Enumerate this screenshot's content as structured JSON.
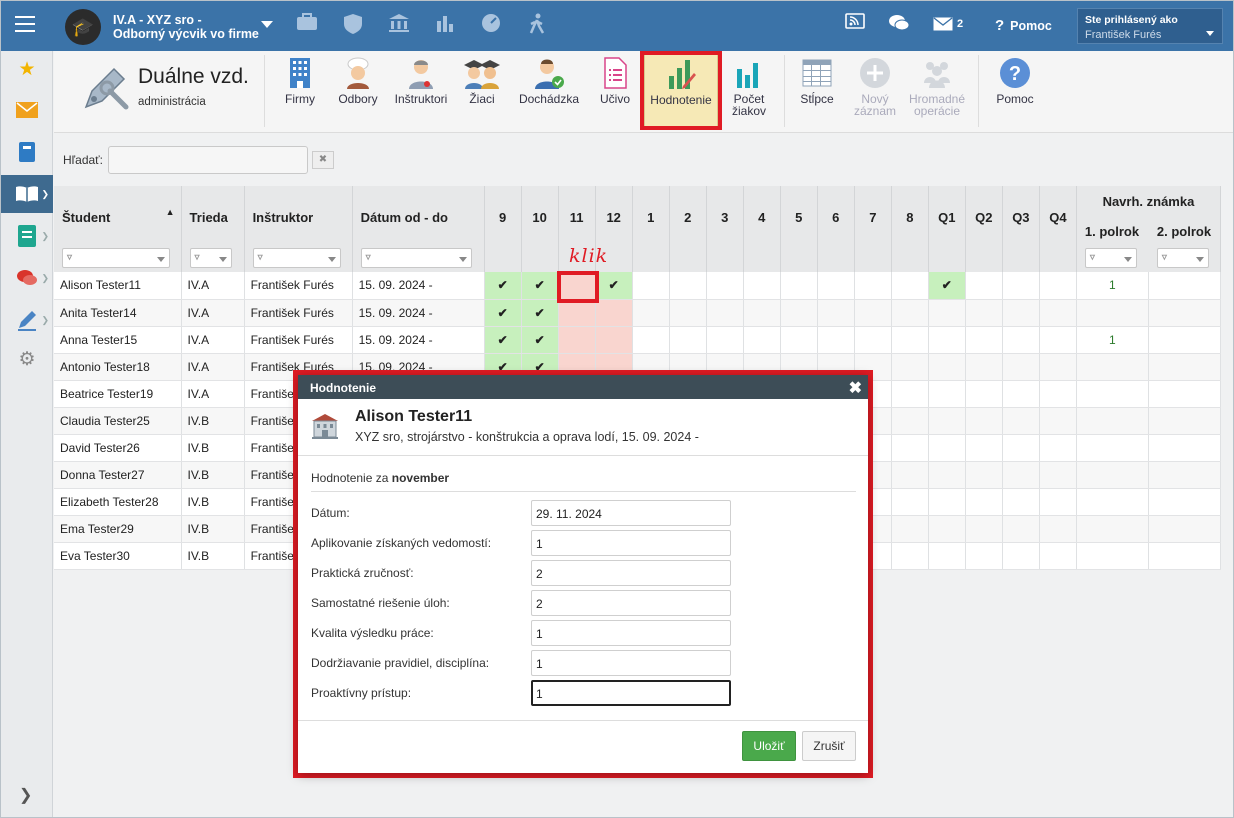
{
  "header": {
    "org_line1": "IV.A - XYZ sro -",
    "org_line2": "Odborný výcvik vo firme",
    "mail_count": "2",
    "help_label": "Pomoc",
    "user_label": "Ste prihlásený ako",
    "user_name": "František Furés"
  },
  "module": {
    "title": "Duálne vzd.",
    "subtitle": "administrácia"
  },
  "toolbar": [
    {
      "label": "Firmy",
      "icon": "building-icon"
    },
    {
      "label": "Odbory",
      "icon": "chef-icon"
    },
    {
      "label": "Inštruktori",
      "icon": "instructor-icon"
    },
    {
      "label": "Žiaci",
      "icon": "students-icon"
    },
    {
      "label": "Dochádzka",
      "icon": "attendance-icon"
    },
    {
      "label": "Učivo",
      "icon": "document-icon"
    },
    {
      "label": "Hodnotenie",
      "icon": "evaluation-chart-icon",
      "active": true
    },
    {
      "label": "Počet",
      "label2": "žiakov",
      "icon": "bar-chart-icon"
    },
    {
      "label": "Stĺpce",
      "icon": "columns-icon"
    },
    {
      "label": "Nový",
      "label2": "záznam",
      "icon": "plus-icon",
      "disabled": true
    },
    {
      "label": "Hromadné",
      "label2": "operácie",
      "icon": "group-icon",
      "disabled": true
    },
    {
      "label": "Pomoc",
      "icon": "help-icon"
    }
  ],
  "search": {
    "label": "Hľadať:",
    "value": ""
  },
  "grid": {
    "headers": {
      "student": "Študent",
      "class": "Trieda",
      "instructor": "Inštruktor",
      "date": "Dátum od - do",
      "months": [
        "9",
        "10",
        "11",
        "12",
        "1",
        "2",
        "3",
        "4",
        "5",
        "6",
        "7",
        "8"
      ],
      "quarters": [
        "Q1",
        "Q2",
        "Q3",
        "Q4"
      ],
      "proposed": "Navrh. známka",
      "half1": "1. polrok",
      "half2": "2. polrok"
    },
    "rows": [
      {
        "name": "Alison Tester11",
        "class": "IV.A",
        "instructor": "František Furés",
        "date": "15. 09. 2024 -",
        "m9": "✔",
        "m10": "✔",
        "m12": "✔",
        "q1": "✔",
        "p1": "1"
      },
      {
        "name": "Anita Tester14",
        "class": "IV.A",
        "instructor": "František Furés",
        "date": "15. 09. 2024 -",
        "m9": "✔",
        "m10": "✔",
        "m12": "",
        "q1": "",
        "p1": ""
      },
      {
        "name": "Anna Tester15",
        "class": "IV.A",
        "instructor": "František Furés",
        "date": "15. 09. 2024 -",
        "m9": "✔",
        "m10": "✔",
        "m12": "",
        "q1": "",
        "p1": "1"
      },
      {
        "name": "Antonio Tester18",
        "class": "IV.A",
        "instructor": "František Furés",
        "date": "15. 09. 2024 -",
        "m9": "✔",
        "m10": "✔",
        "m12": "",
        "q1": "",
        "p1": ""
      },
      {
        "name": "Beatrice Tester19",
        "class": "IV.A",
        "instructor": "František",
        "date": "",
        "m9": "",
        "m10": "",
        "m12": "",
        "q1": "",
        "p1": ""
      },
      {
        "name": "Claudia Tester25",
        "class": "IV.B",
        "instructor": "František",
        "date": "",
        "m9": "",
        "m10": "",
        "m12": "",
        "q1": "",
        "p1": ""
      },
      {
        "name": "David Tester26",
        "class": "IV.B",
        "instructor": "František",
        "date": "",
        "m9": "",
        "m10": "",
        "m12": "",
        "q1": "",
        "p1": ""
      },
      {
        "name": "Donna Tester27",
        "class": "IV.B",
        "instructor": "František",
        "date": "",
        "m9": "",
        "m10": "",
        "m12": "",
        "q1": "",
        "p1": ""
      },
      {
        "name": "Elizabeth Tester28",
        "class": "IV.B",
        "instructor": "František",
        "date": "",
        "m9": "",
        "m10": "",
        "m12": "",
        "q1": "",
        "p1": ""
      },
      {
        "name": "Ema Tester29",
        "class": "IV.B",
        "instructor": "František",
        "date": "",
        "m9": "",
        "m10": "",
        "m12": "",
        "q1": "",
        "p1": ""
      },
      {
        "name": "Eva Tester30",
        "class": "IV.B",
        "instructor": "František",
        "date": "",
        "m9": "",
        "m10": "",
        "m12": "",
        "q1": "",
        "p1": ""
      }
    ]
  },
  "annotation": {
    "klik": "klik"
  },
  "dialog": {
    "title": "Hodnotenie",
    "student": "Alison Tester11",
    "info": "XYZ sro, strojárstvo - konštrukcia a oprava lodí, 15. 09. 2024 -",
    "period_prefix": "Hodnotenie za",
    "period_month": "november",
    "fields": [
      {
        "label": "Dátum:",
        "value": "29. 11. 2024"
      },
      {
        "label": "Aplikovanie získaných vedomostí:",
        "value": "1"
      },
      {
        "label": "Praktická zručnosť:",
        "value": "2"
      },
      {
        "label": "Samostatné riešenie úloh:",
        "value": "2"
      },
      {
        "label": "Kvalita výsledku práce:",
        "value": "1"
      },
      {
        "label": "Dodržiavanie pravidiel, disciplína:",
        "value": "1"
      },
      {
        "label": "Proaktívny prístup:",
        "value": "1"
      }
    ],
    "save": "Uložiť",
    "cancel": "Zrušiť"
  },
  "colors": {
    "topbar": "#3b73a8",
    "highlight": "#e01b24",
    "green_cell": "#c7f0bd",
    "red_cell": "#f9d5cf",
    "save": "#4aa94b"
  }
}
